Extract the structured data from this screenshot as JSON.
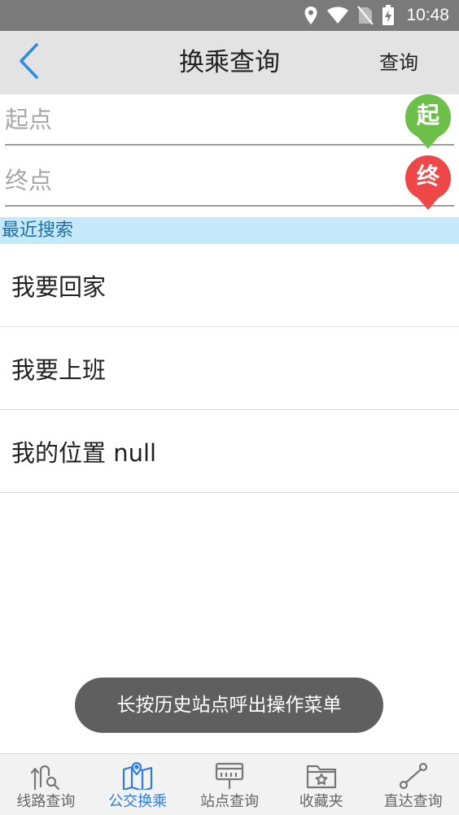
{
  "status_bar": {
    "time": "10:48",
    "icons": [
      "location-icon",
      "wifi-icon",
      "no-sim-icon",
      "battery-charging-icon"
    ]
  },
  "app_bar": {
    "title": "换乘查询",
    "action_label": "查询",
    "back_icon": "chevron-left-icon"
  },
  "form": {
    "start_placeholder": "起点",
    "end_placeholder": "终点",
    "start_pin_label": "起",
    "end_pin_label": "终",
    "start_pin_color": "#6cc04a",
    "end_pin_color": "#ef4747"
  },
  "recent": {
    "header": "最近搜索",
    "items": [
      "我要回家",
      "我要上班",
      "我的位置 null"
    ]
  },
  "toast": {
    "text": "长按历史站点呼出操作菜单"
  },
  "bottom_nav": {
    "active_color": "#2c7be5",
    "items": [
      {
        "label": "线路查询",
        "icon": "route-search-icon"
      },
      {
        "label": "公交换乘",
        "icon": "map-icon",
        "active": true
      },
      {
        "label": "站点查询",
        "icon": "bus-stop-icon"
      },
      {
        "label": "收藏夹",
        "icon": "favorites-folder-icon"
      },
      {
        "label": "直达查询",
        "icon": "direct-route-icon"
      }
    ]
  }
}
